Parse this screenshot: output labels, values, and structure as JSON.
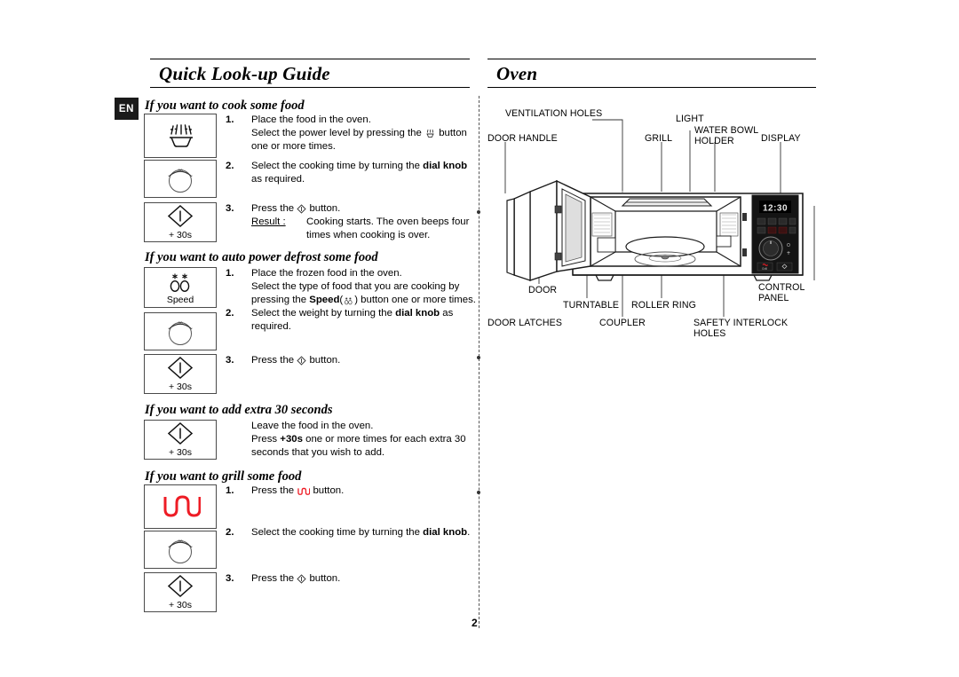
{
  "document": {
    "page_number": "2",
    "language_badge": "EN"
  },
  "left_column": {
    "header_title": "Quick Look-up Guide",
    "sections": [
      {
        "id": "cook",
        "heading": "If you want to cook some food",
        "icons": [
          {
            "name": "microwave-power-icon",
            "glyph": "power-level",
            "caption": ""
          },
          {
            "name": "dial-knob-icon",
            "glyph": "dial",
            "caption": ""
          },
          {
            "name": "start-30s-icon",
            "glyph": "start",
            "caption": "+ 30s"
          }
        ],
        "steps": [
          {
            "num": "1.",
            "lines": [
              "Place the food in the oven.",
              "Select the power level by pressing the",
              "button one or more times."
            ]
          },
          {
            "num": "2.",
            "lines": [
              "Select the cooking time by turning the",
              "dial knob",
              "as required."
            ]
          },
          {
            "num": "3.",
            "lines": [
              "Press the",
              "button."
            ],
            "result_label": "Result :",
            "result_text": "Cooking starts. The oven beeps four times when cooking is over."
          }
        ]
      },
      {
        "id": "defrost",
        "heading": "If you want to auto power defrost some food",
        "icons": [
          {
            "name": "speed-defrost-icon",
            "glyph": "defrost",
            "caption": "Speed"
          },
          {
            "name": "dial-knob-icon",
            "glyph": "dial",
            "caption": ""
          },
          {
            "name": "start-30s-icon",
            "glyph": "start",
            "caption": "+ 30s"
          }
        ],
        "steps": [
          {
            "num": "1.",
            "lines": [
              "Place the frozen food in the oven.",
              "Select the type of food that you are cooking by pressing the",
              "Speed",
              "(",
              ") button one or more times."
            ]
          },
          {
            "num": "2.",
            "lines": [
              "Select the weight by turning the",
              "dial knob",
              "as required."
            ]
          },
          {
            "num": "3.",
            "lines": [
              "Press the",
              "button."
            ]
          }
        ]
      },
      {
        "id": "extra30",
        "heading": "If you want to add extra 30 seconds",
        "icons": [
          {
            "name": "start-30s-icon",
            "glyph": "start",
            "caption": "+ 30s"
          }
        ],
        "steps": [
          {
            "num": "",
            "lines": [
              "Leave the food in the oven.",
              "Press",
              "+30s",
              "one or more times for each extra 30 seconds that you wish to add."
            ]
          }
        ]
      },
      {
        "id": "grill",
        "heading": "If you want to grill some food",
        "icons": [
          {
            "name": "grill-element-icon",
            "glyph": "grill",
            "caption": ""
          },
          {
            "name": "dial-knob-icon",
            "glyph": "dial",
            "caption": ""
          },
          {
            "name": "start-30s-icon",
            "glyph": "start",
            "caption": "+ 30s"
          }
        ],
        "steps": [
          {
            "num": "1.",
            "lines": [
              "Press the",
              "button."
            ]
          },
          {
            "num": "2.",
            "lines": [
              "Select the cooking time by turning the",
              "dial knob",
              "."
            ]
          },
          {
            "num": "3.",
            "lines": [
              "Press the",
              "button."
            ]
          }
        ]
      }
    ]
  },
  "right_column": {
    "header_title": "Oven",
    "display_value": "12:30",
    "labels": [
      {
        "id": "ventilation-holes",
        "text": "VENTILATION HOLES"
      },
      {
        "id": "door-handle",
        "text": "DOOR HANDLE"
      },
      {
        "id": "light",
        "text": "LIGHT"
      },
      {
        "id": "grill",
        "text": "GRILL"
      },
      {
        "id": "water-bowl-holder",
        "text": "WATER BOWL\nHOLDER"
      },
      {
        "id": "display",
        "text": "DISPLAY"
      },
      {
        "id": "door",
        "text": "DOOR"
      },
      {
        "id": "turntable",
        "text": "TURNTABLE"
      },
      {
        "id": "roller-ring",
        "text": "ROLLER RING"
      },
      {
        "id": "door-latches",
        "text": "DOOR LATCHES"
      },
      {
        "id": "coupler",
        "text": "COUPLER"
      },
      {
        "id": "safety-interlock-holes",
        "text": "SAFETY INTERLOCK\nHOLES"
      },
      {
        "id": "control-panel",
        "text": "CONTROL PANEL"
      }
    ]
  },
  "colors": {
    "grill_red": "#ee1c25",
    "panel_black": "#141414",
    "badge_black": "#1a1a1a"
  }
}
